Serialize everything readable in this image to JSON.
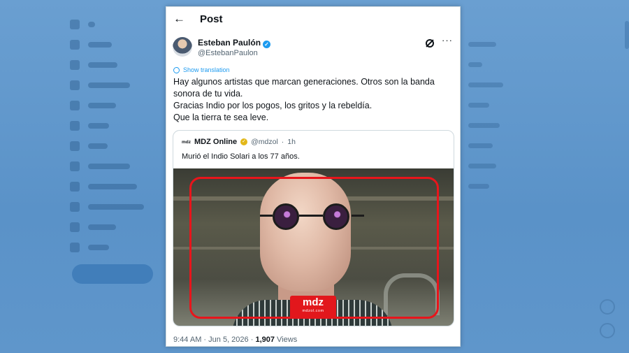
{
  "header": {
    "back_icon": "arrow-left-icon",
    "title": "Post"
  },
  "author": {
    "name": "Esteban Paulón",
    "handle": "@EstebanPaulon",
    "verified_icon": "verified-badge-icon"
  },
  "translate_label": "Show translation",
  "body_lines": [
    "Hay algunos artistas que marcan generaciones. Otros son la banda",
    "sonora de tu vida.",
    "Gracias Indio por los pogos, los gritos y la rebeldía.",
    "Que la tierra te sea leve."
  ],
  "quote": {
    "logo_text": "mdz",
    "name": "MDZ Online",
    "handle": "@mdzol",
    "separator": "·",
    "time": "1h",
    "text": "Murió el Indio Solari a los 77 años.",
    "image_badge_main": "mdz",
    "image_badge_sub": "mdzol.com"
  },
  "meta": {
    "time": "9:44 AM",
    "date": "Jun 5, 2026",
    "views_count": "1,907",
    "views_label": "Views"
  },
  "colors": {
    "link": "#1d9bf0",
    "highlight_frame": "#e8151b",
    "badge": "#e2171c"
  }
}
